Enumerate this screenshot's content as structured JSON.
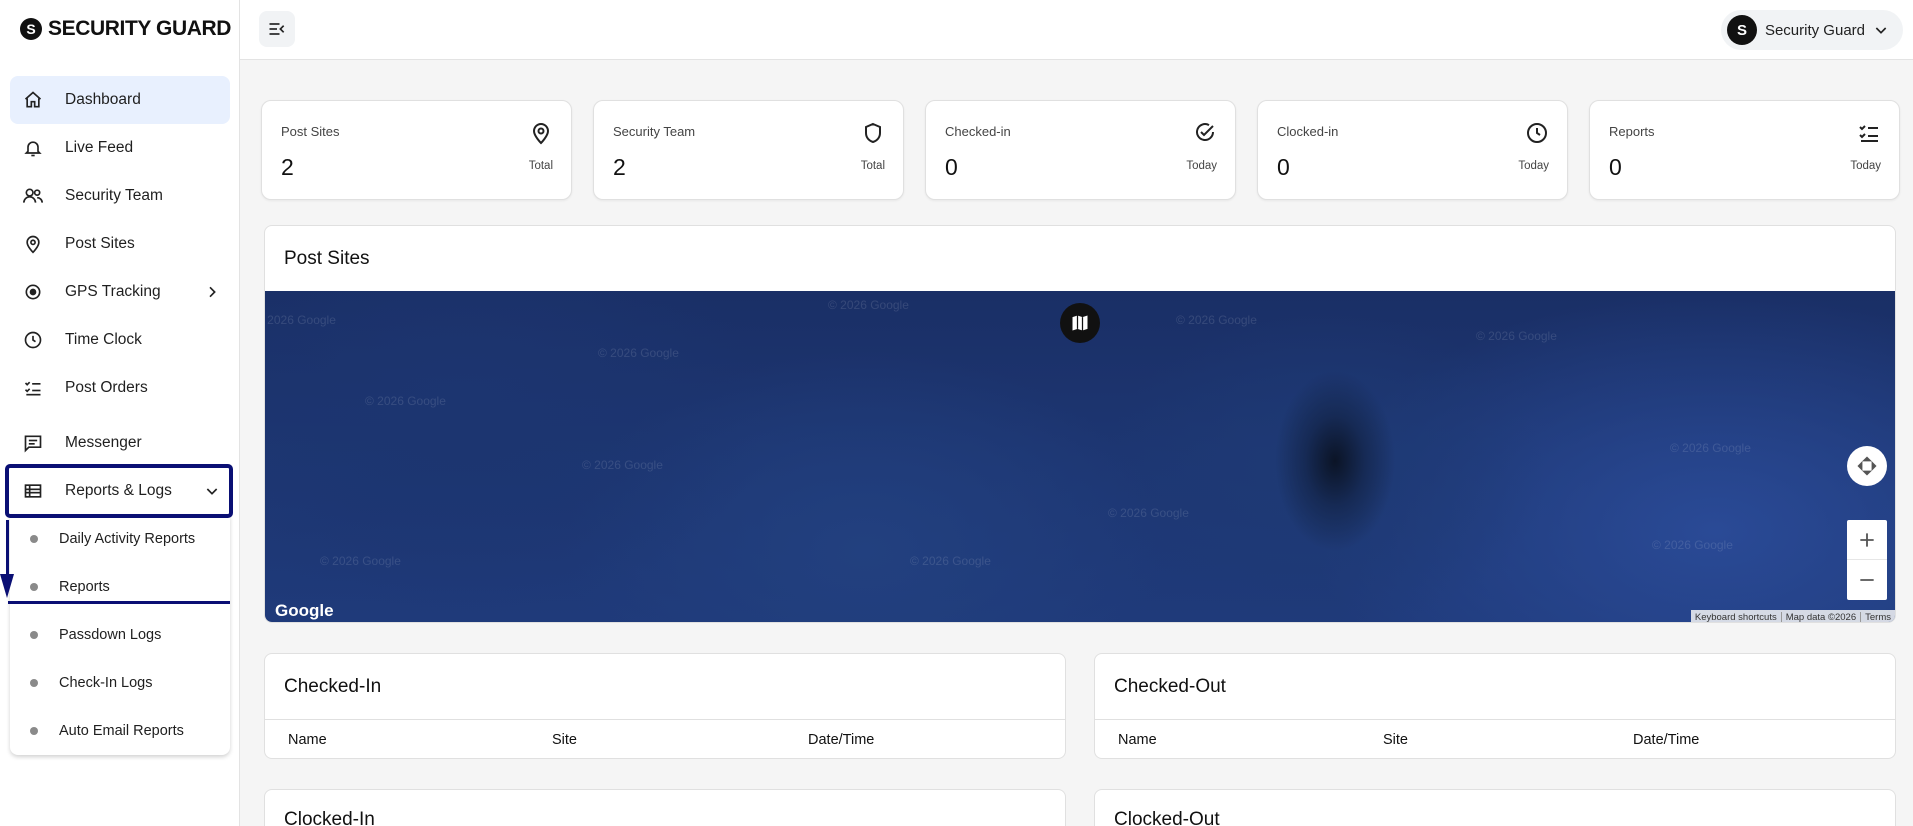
{
  "brand": {
    "logo_letter": "S",
    "name": "SECURITY GUARD"
  },
  "sidebar": {
    "items": [
      {
        "label": "Dashboard",
        "icon": "home-icon"
      },
      {
        "label": "Live Feed",
        "icon": "bell-icon"
      },
      {
        "label": "Security Team",
        "icon": "users-icon"
      },
      {
        "label": "Post Sites",
        "icon": "map-pin-icon"
      },
      {
        "label": "GPS Tracking",
        "icon": "gps-icon"
      },
      {
        "label": "Time Clock",
        "icon": "clock-icon"
      },
      {
        "label": "Post Orders",
        "icon": "checklist-icon"
      },
      {
        "label": "Messenger",
        "icon": "message-icon"
      },
      {
        "label": "Reports & Logs",
        "icon": "list-icon"
      }
    ],
    "sub_items": [
      {
        "label": "Daily Activity Reports"
      },
      {
        "label": "Reports"
      },
      {
        "label": "Passdown Logs"
      },
      {
        "label": "Check-In Logs"
      },
      {
        "label": "Auto Email Reports"
      }
    ]
  },
  "header": {
    "user": {
      "initial": "S",
      "name": "Security Guard"
    }
  },
  "stats": [
    {
      "label": "Post Sites",
      "value": "2",
      "sub": "Total",
      "icon": "map-pin-icon"
    },
    {
      "label": "Security Team",
      "value": "2",
      "sub": "Total",
      "icon": "shield-icon"
    },
    {
      "label": "Checked-in",
      "value": "0",
      "sub": "Today",
      "icon": "check-circle-icon"
    },
    {
      "label": "Clocked-in",
      "value": "0",
      "sub": "Today",
      "icon": "clock-icon"
    },
    {
      "label": "Reports",
      "value": "0",
      "sub": "Today",
      "icon": "checklist-icon"
    }
  ],
  "map_panel": {
    "title": "Post Sites",
    "watermark": "© 2026 Google",
    "google": "Google",
    "footer": [
      "Keyboard shortcuts",
      "Map data ©2026",
      "Terms"
    ]
  },
  "tables": [
    {
      "title": "Checked-In",
      "columns": [
        "Name",
        "Site",
        "Date/Time"
      ]
    },
    {
      "title": "Checked-Out",
      "columns": [
        "Name",
        "Site",
        "Date/Time"
      ]
    },
    {
      "title": "Clocked-In"
    },
    {
      "title": "Clocked-Out"
    }
  ]
}
